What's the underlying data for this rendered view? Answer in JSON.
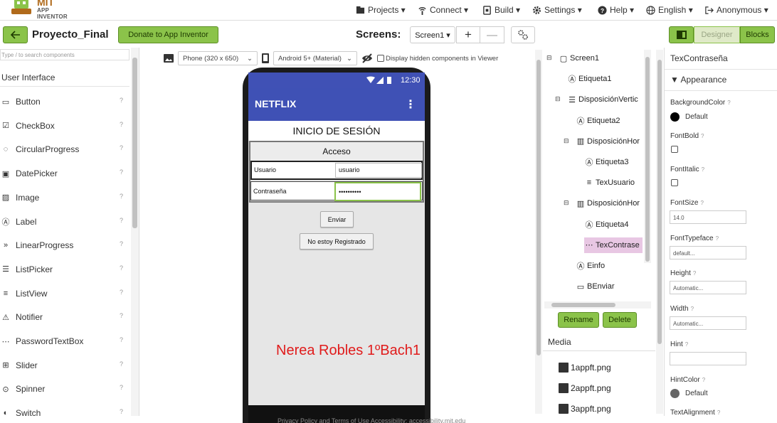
{
  "app": {
    "brand_main": "MIT",
    "brand_sub": "APP INVENTOR"
  },
  "topmenu": {
    "projects": "Projects ▾",
    "connect": "Connect ▾",
    "build": "Build ▾",
    "settings": "Settings ▾",
    "help": "Help ▾",
    "language": "English ▾",
    "account": "Anonymous ▾"
  },
  "toolbar": {
    "project_name": "Proyecto_Final",
    "donate_label": "Donate to App Inventor",
    "screens_label": "Screens:",
    "screen_selected": "Screen1 ▾",
    "add_screen": "+",
    "remove_screen": "—",
    "designer_label": "Designer",
    "blocks_label": "Blocks"
  },
  "palette": {
    "search_placeholder": "Type / to search components",
    "category": "User Interface",
    "items": [
      {
        "label": "Button",
        "icon": "button-icon"
      },
      {
        "label": "CheckBox",
        "icon": "checkbox-icon"
      },
      {
        "label": "CircularProgress",
        "icon": "circular-progress-icon"
      },
      {
        "label": "DatePicker",
        "icon": "calendar-icon"
      },
      {
        "label": "Image",
        "icon": "image-icon"
      },
      {
        "label": "Label",
        "icon": "label-icon"
      },
      {
        "label": "LinearProgress",
        "icon": "double-chevron-icon"
      },
      {
        "label": "ListPicker",
        "icon": "list-picker-icon"
      },
      {
        "label": "ListView",
        "icon": "list-view-icon"
      },
      {
        "label": "Notifier",
        "icon": "warning-icon"
      },
      {
        "label": "PasswordTextBox",
        "icon": "password-icon"
      },
      {
        "label": "Slider",
        "icon": "slider-icon"
      },
      {
        "label": "Spinner",
        "icon": "spinner-icon"
      },
      {
        "label": "Switch",
        "icon": "switch-icon"
      }
    ],
    "help_glyph": "?"
  },
  "viewer": {
    "phone_size": "Phone (320 x 650)",
    "theme": "Android 5+ (Material)",
    "hidden_label": "Display hidden components in Viewer"
  },
  "phone": {
    "time": "12:30",
    "app_title": "NETFLIX",
    "menu_glyph": "⋮",
    "heading": "INICIO DE SESIÓN",
    "section": "Acceso",
    "user_label": "Usuario",
    "user_value": "usuario",
    "pass_label": "Contraseña",
    "pass_value": "••••••••••",
    "send_button": "Enviar",
    "register_button": "No estoy Registrado"
  },
  "watermark": "Nerea Robles 1ºBach1",
  "tree": {
    "nodes": [
      {
        "label": "Screen1",
        "icon": "screen-icon"
      },
      {
        "label": "Etiqueta1",
        "icon": "label-icon"
      },
      {
        "label": "DisposiciónVertic",
        "icon": "vertical-arrangement-icon"
      },
      {
        "label": "Etiqueta2",
        "icon": "label-icon"
      },
      {
        "label": "DisposiciónHor",
        "icon": "horizontal-arrangement-icon"
      },
      {
        "label": "Etiqueta3",
        "icon": "label-icon"
      },
      {
        "label": "TexUsuario",
        "icon": "textbox-icon"
      },
      {
        "label": "DisposiciónHor",
        "icon": "horizontal-arrangement-icon"
      },
      {
        "label": "Etiqueta4",
        "icon": "label-icon"
      },
      {
        "label": "TexContrase",
        "icon": "password-icon"
      },
      {
        "label": "Einfo",
        "icon": "label-icon"
      },
      {
        "label": "BEnviar",
        "icon": "button-icon"
      }
    ],
    "collapse_glyph": "⊟"
  },
  "tree_actions": {
    "rename": "Rename",
    "delete": "Delete"
  },
  "media": {
    "title": "Media",
    "files": [
      "1appft.png",
      "2appft.png",
      "3appft.png"
    ]
  },
  "properties": {
    "component": "TexContraseña",
    "section": "▼ Appearance",
    "background_color_label": "BackgroundColor",
    "background_color_value": "Default",
    "fontbold_label": "FontBold",
    "fontitalic_label": "FontItalic",
    "fontsize_label": "FontSize",
    "fontsize_value": "14.0",
    "fonttypeface_label": "FontTypeface",
    "fonttypeface_value": "default...",
    "height_label": "Height",
    "height_value": "Automatic...",
    "width_label": "Width",
    "width_value": "Automatic...",
    "hint_label": "Hint",
    "hint_value": "",
    "hintcolor_label": "HintColor",
    "hintcolor_value": "Default",
    "textalign_label": "TextAlignment",
    "help_glyph": "?"
  },
  "footer": "Privacy Policy and Terms of Use      Accessibility: accessibility.mit.edu",
  "colors": {
    "accent_green": "#8bc34a",
    "app_bar": "#3f51b5",
    "watermark": "#e01b1b",
    "selection": "#e8c7e3"
  }
}
